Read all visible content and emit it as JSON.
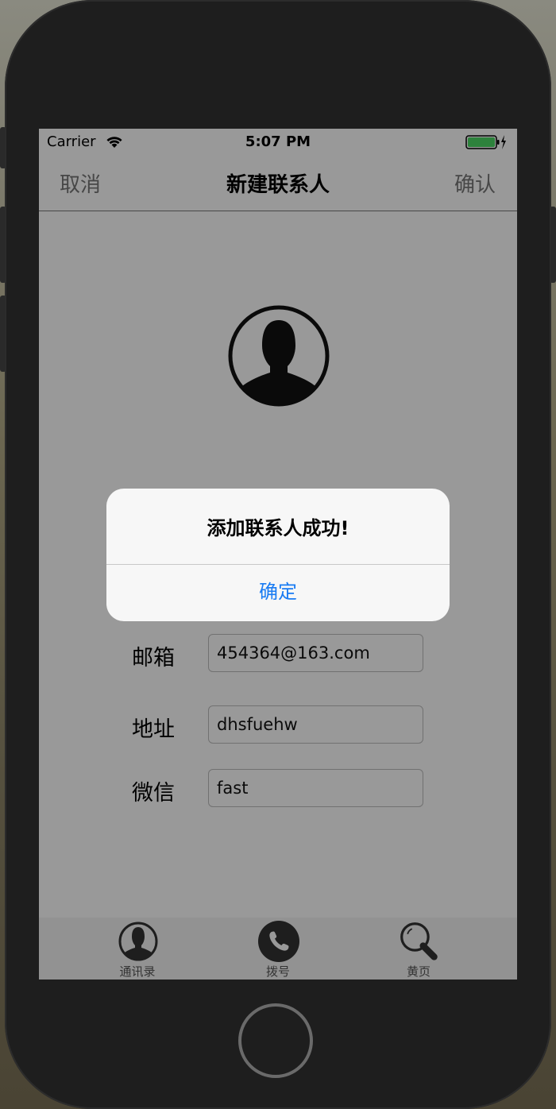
{
  "status_bar": {
    "carrier": "Carrier",
    "time": "5:07 PM",
    "battery_color": "#4cd964"
  },
  "nav": {
    "cancel_label": "取消",
    "title": "新建联系人",
    "confirm_label": "确认"
  },
  "form": {
    "fields": [
      {
        "label": "邮箱",
        "value": "454364@163.com"
      },
      {
        "label": "地址",
        "value": "dhsfuehw"
      },
      {
        "label": "微信",
        "value": "fast"
      }
    ]
  },
  "tab_bar": {
    "items": [
      {
        "label": "通讯录",
        "icon": "contact-person-icon"
      },
      {
        "label": "拨号",
        "icon": "phone-icon"
      },
      {
        "label": "黄页",
        "icon": "magnifier-icon"
      }
    ]
  },
  "alert": {
    "message": "添加联系人成功!",
    "ok_label": "确定",
    "ok_color": "#1a7cf3"
  }
}
